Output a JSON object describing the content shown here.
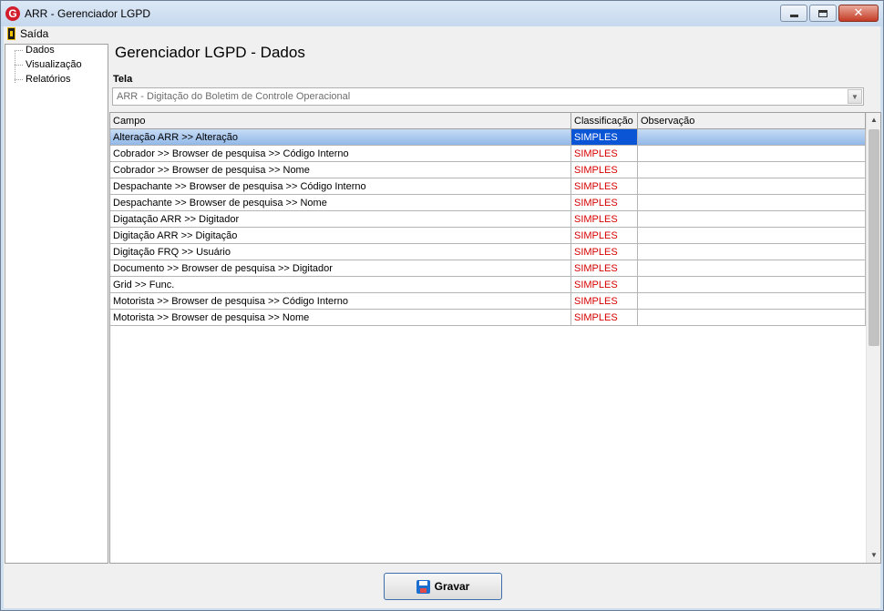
{
  "window": {
    "title": "ARR - Gerenciador LGPD",
    "icon_letter": "G",
    "controls": [
      "minimize-icon",
      "maximize-icon",
      "close-icon"
    ]
  },
  "menu": {
    "exit_label": "Saída"
  },
  "tree": {
    "items": [
      "Dados",
      "Visualização",
      "Relatórios"
    ]
  },
  "heading": "Gerenciador LGPD - Dados",
  "tela": {
    "label": "Tela",
    "value": "ARR - Digitação do Boletim de Controle Operacional"
  },
  "grid": {
    "columns": [
      "Campo",
      "Classificação",
      "Observação"
    ],
    "rows": [
      {
        "campo": "Alteração ARR >> Alteração",
        "classificacao": "SIMPLES",
        "observacao": "",
        "selected": true
      },
      {
        "campo": "Cobrador >> Browser de pesquisa >> Código Interno",
        "classificacao": "SIMPLES",
        "observacao": ""
      },
      {
        "campo": "Cobrador >> Browser de pesquisa >> Nome",
        "classificacao": "SIMPLES",
        "observacao": ""
      },
      {
        "campo": "Despachante >> Browser de pesquisa >> Código Interno",
        "classificacao": "SIMPLES",
        "observacao": ""
      },
      {
        "campo": "Despachante >> Browser de pesquisa >> Nome",
        "classificacao": "SIMPLES",
        "observacao": ""
      },
      {
        "campo": "Digatação ARR >> Digitador",
        "classificacao": "SIMPLES",
        "observacao": ""
      },
      {
        "campo": "Digitação ARR >> Digitação",
        "classificacao": "SIMPLES",
        "observacao": ""
      },
      {
        "campo": "Digitação FRQ >> Usuário",
        "classificacao": "SIMPLES",
        "observacao": ""
      },
      {
        "campo": "Documento >> Browser de pesquisa >> Digitador",
        "classificacao": "SIMPLES",
        "observacao": ""
      },
      {
        "campo": "Grid >> Func.",
        "classificacao": "SIMPLES",
        "observacao": ""
      },
      {
        "campo": "Motorista >> Browser de pesquisa >> Código Interno",
        "classificacao": "SIMPLES",
        "observacao": ""
      },
      {
        "campo": "Motorista >> Browser de pesquisa >> Nome",
        "classificacao": "SIMPLES",
        "observacao": ""
      }
    ]
  },
  "save_button": {
    "label": "Gravar",
    "icon": "floppy-disk-icon"
  },
  "colors": {
    "classification_text": "#d60000",
    "selection": "#0a54d6",
    "button_border": "#3d6fb0"
  }
}
